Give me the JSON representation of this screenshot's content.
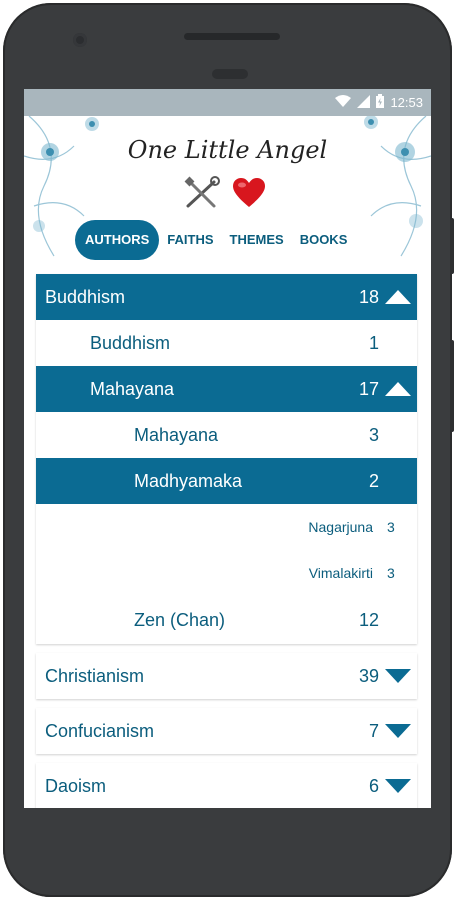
{
  "status": {
    "time": "12:53"
  },
  "app": {
    "title": "One Little Angel"
  },
  "icons": {
    "tools": "tools-icon",
    "heart": "heart-icon"
  },
  "tabs": [
    {
      "label": "AUTHORS",
      "active": true
    },
    {
      "label": "FAITHS",
      "active": false
    },
    {
      "label": "THEMES",
      "active": false
    },
    {
      "label": "BOOKS",
      "active": false
    }
  ],
  "tree": {
    "buddhism": {
      "label": "Buddhism",
      "count": "18",
      "children": {
        "buddhism": {
          "label": "Buddhism",
          "count": "1"
        },
        "mahayana": {
          "label": "Mahayana",
          "count": "17",
          "children": {
            "mahayana": {
              "label": "Mahayana",
              "count": "3"
            },
            "madhyamaka": {
              "label": "Madhyamaka",
              "count": "2",
              "children": {
                "nagarjuna": {
                  "label": "Nagarjuna",
                  "count": "3"
                },
                "vimalakirti": {
                  "label": "Vimalakirti",
                  "count": "3"
                }
              }
            },
            "zen": {
              "label": "Zen (Chan)",
              "count": "12"
            }
          }
        }
      }
    },
    "christianism": {
      "label": "Christianism",
      "count": "39"
    },
    "confucianism": {
      "label": "Confucianism",
      "count": "7"
    },
    "daoism": {
      "label": "Daoism",
      "count": "6"
    }
  },
  "colors": {
    "accent": "#0b6b93",
    "text": "#0b5d7d",
    "statusbar": "#a9b6bd"
  }
}
